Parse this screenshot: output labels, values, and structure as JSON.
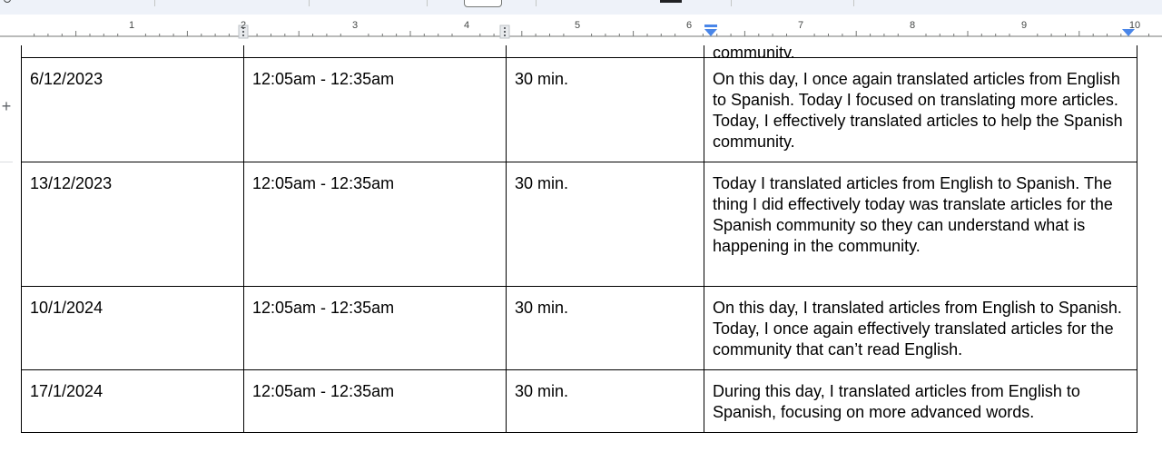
{
  "ruler": {
    "numbers": [
      "1",
      "2",
      "3",
      "4",
      "5",
      "6",
      "7",
      "8",
      "9",
      "10"
    ]
  },
  "table": {
    "cut_row": {
      "col4": "community."
    },
    "rows": [
      {
        "date": "6/12/2023",
        "time": "12:05am - 12:35am",
        "duration": "30 min.",
        "description": "On this day, I once again translated articles from English to Spanish. Today I focused on translating more articles. Today, I effectively translated articles to help the Spanish community."
      },
      {
        "date": "13/12/2023",
        "time": "12:05am - 12:35am",
        "duration": "30 min.",
        "description": "Today I translated articles from English to Spanish. The thing I did effectively today was translate articles for the Spanish community so they can understand what is happening in the community."
      },
      {
        "date": "10/1/2024",
        "time": "12:05am - 12:35am",
        "duration": "30 min.",
        "description": "On this day, I translated articles from English to Spanish. Today, I once again effectively translated articles for the community that can’t read English."
      },
      {
        "date": "17/1/2024",
        "time": "12:05am - 12:35am",
        "duration": "30 min.",
        "description": "During this day, I translated articles from English to Spanish, focusing on more advanced words."
      }
    ]
  },
  "colors": {
    "ruler_marker": "#4a86e8",
    "toolbar_bg": "#eef2f9"
  }
}
